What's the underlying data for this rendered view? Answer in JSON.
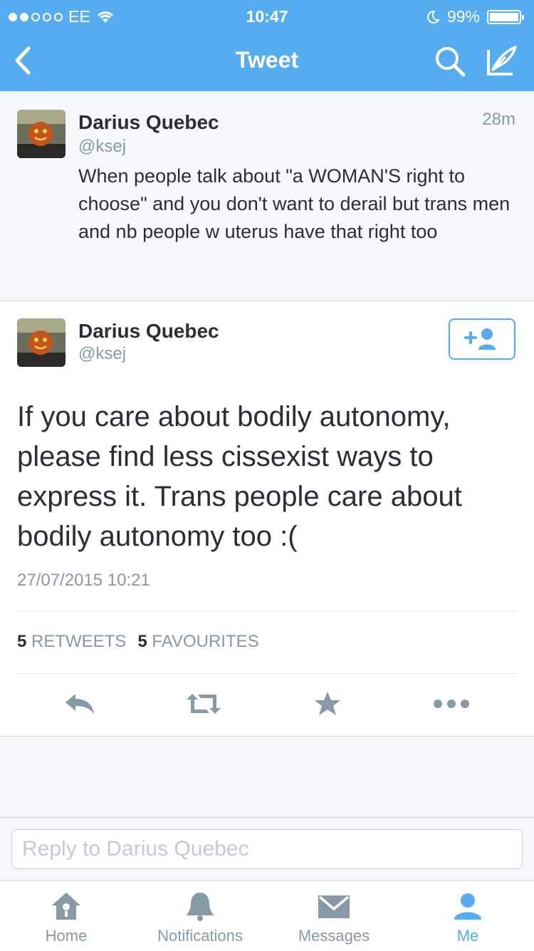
{
  "status": {
    "carrier": "EE",
    "time": "10:47",
    "battery": "99%",
    "battery_level": 0.99
  },
  "nav": {
    "title": "Tweet"
  },
  "previous_tweet": {
    "name": "Darius Quebec",
    "handle": "@ksej",
    "time": "28m",
    "text": "When people talk about \"a WOMAN'S right to choose\" and you don't want to derail but trans men and nb people w uterus have that right too"
  },
  "tweet": {
    "name": "Darius Quebec",
    "handle": "@ksej",
    "text": "If you care about bodily autonomy, please find less cissexist ways to express it. Trans people care about bodily autonomy too :(",
    "date": "27/07/2015 10:21",
    "retweets_count": "5",
    "retweets_label": "RETWEETS",
    "favourites_count": "5",
    "favourites_label": "FAVOURITES"
  },
  "reply": {
    "placeholder": "Reply to Darius Quebec"
  },
  "tabs": [
    {
      "label": "Home",
      "icon": "home-icon"
    },
    {
      "label": "Notifications",
      "icon": "bell-icon"
    },
    {
      "label": "Messages",
      "icon": "envelope-icon"
    },
    {
      "label": "Me",
      "icon": "person-icon"
    }
  ],
  "colors": {
    "brand": "#55acee",
    "muted": "#8899a6",
    "text": "#292f33"
  }
}
